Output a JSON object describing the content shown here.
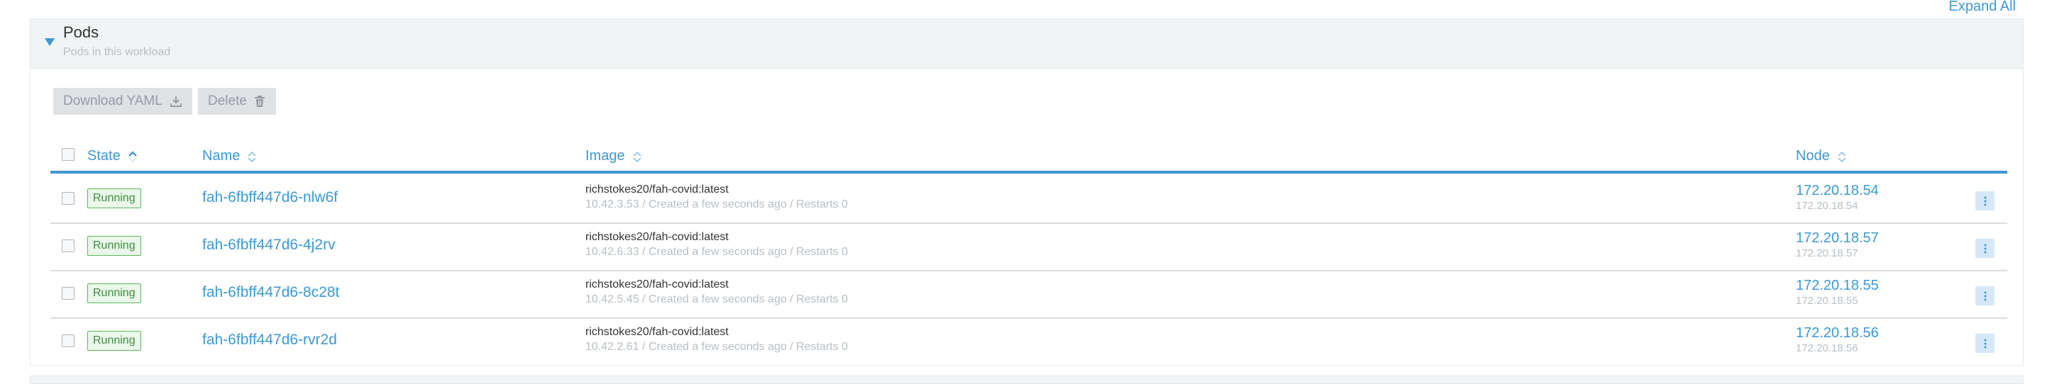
{
  "expand_all": "Expand All",
  "section": {
    "title": "Pods",
    "subtitle": "Pods in this workload"
  },
  "toolbar": {
    "download_yaml": "Download YAML",
    "delete": "Delete"
  },
  "columns": {
    "state": "State",
    "name": "Name",
    "image": "Image",
    "node": "Node"
  },
  "rows": [
    {
      "state": "Running",
      "name": "fah-6fbff447d6-nlw6f",
      "image": "richstokes20/fah-covid:latest",
      "image_detail": "10.42.3.53 / Created a few seconds ago / Restarts 0",
      "node": "172.20.18.54",
      "node_ip": "172.20.18.54"
    },
    {
      "state": "Running",
      "name": "fah-6fbff447d6-4j2rv",
      "image": "richstokes20/fah-covid:latest",
      "image_detail": "10.42.6.33 / Created a few seconds ago / Restarts 0",
      "node": "172.20.18.57",
      "node_ip": "172.20.18.57"
    },
    {
      "state": "Running",
      "name": "fah-6fbff447d6-8c28t",
      "image": "richstokes20/fah-covid:latest",
      "image_detail": "10.42.5.45 / Created a few seconds ago / Restarts 0",
      "node": "172.20.18.55",
      "node_ip": "172.20.18.55"
    },
    {
      "state": "Running",
      "name": "fah-6fbff447d6-rvr2d",
      "image": "richstokes20/fah-covid:latest",
      "image_detail": "10.42.2.61 / Created a few seconds ago / Restarts 0",
      "node": "172.20.18.56",
      "node_ip": "172.20.18.56"
    }
  ],
  "colors": {
    "accent": "#3d98d3",
    "running": "#5cb85c",
    "header_bg": "#f1f4f5"
  },
  "icons": {
    "toggle": "caret-down-icon",
    "download": "download-icon",
    "delete": "trash-icon",
    "sort": "sort-icon",
    "row_menu": "kebab-icon"
  }
}
